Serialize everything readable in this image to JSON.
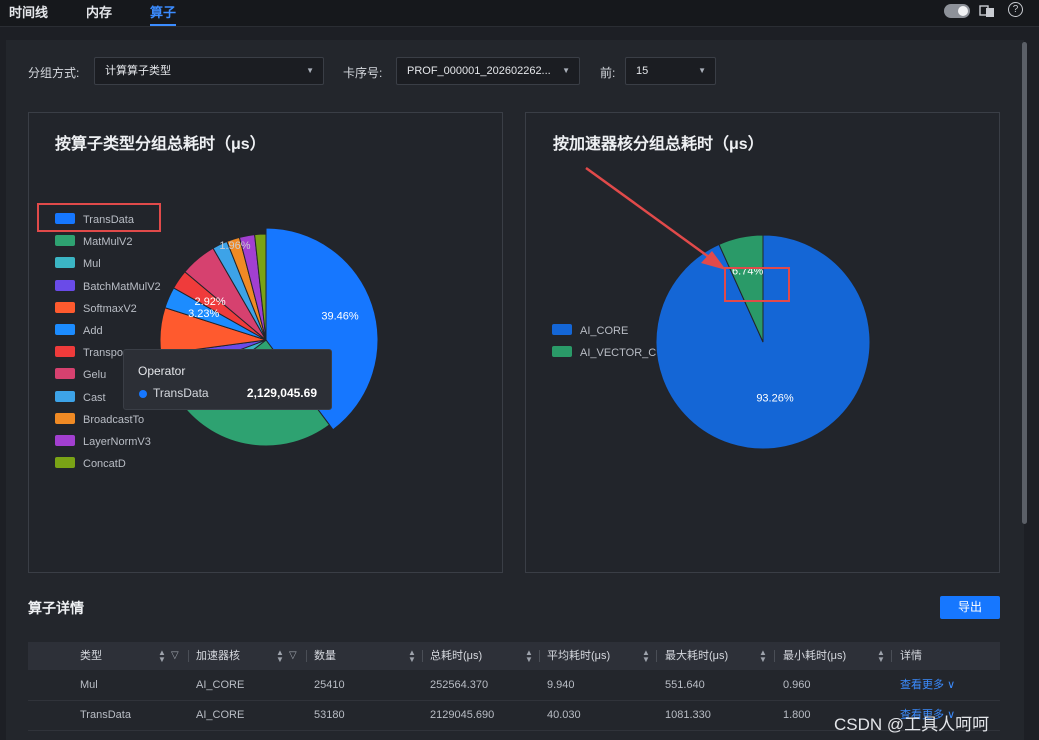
{
  "tabs": [
    {
      "label": "时间线"
    },
    {
      "label": "内存"
    },
    {
      "label": "算子"
    }
  ],
  "top_icons": {
    "toggle": "toggle-switch",
    "translate": "translate-icon",
    "help": "help-icon",
    "help_glyph": "?"
  },
  "filters": {
    "group_label": "分组方式:",
    "group_value": "计算算子类型",
    "card_label": "卡序号:",
    "card_value": "PROF_000001_202602262...",
    "top_label": "前:",
    "top_value": "15"
  },
  "chart_left": {
    "title": "按算子类型分组总耗时（μs）",
    "legend": [
      {
        "name": "TransData",
        "color": "#1677ff"
      },
      {
        "name": "MatMulV2",
        "color": "#2ea271"
      },
      {
        "name": "Mul",
        "color": "#3bb5c4"
      },
      {
        "name": "BatchMatMulV2",
        "color": "#6a4be8"
      },
      {
        "name": "SoftmaxV2",
        "color": "#ff5a2e"
      },
      {
        "name": "Add",
        "color": "#1c8cff"
      },
      {
        "name": "Transpo",
        "color": "#ef3b3b"
      },
      {
        "name": "Gelu",
        "color": "#d6416f"
      },
      {
        "name": "Cast",
        "color": "#3da3e8"
      },
      {
        "name": "BroadcastTo",
        "color": "#f08a24"
      },
      {
        "name": "LayerNormV3",
        "color": "#a23fd0"
      },
      {
        "name": "ConcatD",
        "color": "#7aa316"
      }
    ],
    "tooltip": {
      "header": "Operator",
      "name": "TransData",
      "value": "2,129,045.69"
    }
  },
  "chart_right": {
    "title": "按加速器核分组总耗时（μs）",
    "legend": [
      {
        "name": "AI_CORE",
        "color": "#1466d6"
      },
      {
        "name": "AI_VECTOR_CORE",
        "color": "#2a9a68"
      }
    ]
  },
  "chart_data": [
    {
      "type": "pie",
      "title": "按算子类型分组总耗时（μs）",
      "series_label": "Operator",
      "slices": [
        {
          "name": "TransData",
          "value": 39.46,
          "label": "39.46%",
          "color": "#1677ff"
        },
        {
          "name": "MatMulV2",
          "value": 24.6,
          "color": "#2ea271"
        },
        {
          "name": "Mul",
          "value": 4.68,
          "color": "#3bb5c4"
        },
        {
          "name": "BatchMatMulV2",
          "value": 3.52,
          "label": "3.52%",
          "color": "#6a4be8"
        },
        {
          "name": "SoftmaxV2",
          "value": 7.0,
          "color": "#ff5a2e"
        },
        {
          "name": "Add",
          "value": 3.23,
          "label": "3.23%",
          "color": "#1c8cff"
        },
        {
          "name": "Transpo",
          "value": 2.92,
          "label": "2.92%",
          "color": "#ef3b3b"
        },
        {
          "name": "Gelu",
          "value": 5.5,
          "color": "#d6416f"
        },
        {
          "name": "Cast",
          "value": 2.3,
          "color": "#3da3e8"
        },
        {
          "name": "BroadcastTo",
          "value": 1.96,
          "label": "1.96%",
          "color": "#f08a24"
        },
        {
          "name": "LayerNormV3",
          "value": 2.3,
          "color": "#a23fd0"
        },
        {
          "name": "ConcatD",
          "value": 1.7,
          "color": "#7aa316"
        }
      ]
    },
    {
      "type": "pie",
      "title": "按加速器核分组总耗时（μs）",
      "slices": [
        {
          "name": "AI_CORE",
          "value": 93.26,
          "label": "93.26%",
          "color": "#1466d6"
        },
        {
          "name": "AI_VECTOR_CORE",
          "value": 6.74,
          "label": "6.74%",
          "color": "#2a9a68"
        }
      ]
    }
  ],
  "details": {
    "title": "算子详情",
    "export_label": "导出",
    "columns": [
      "类型",
      "加速器核",
      "数量",
      "总耗时(μs)",
      "平均耗时(μs)",
      "最大耗时(μs)",
      "最小耗时(μs)",
      "详情"
    ],
    "rows": [
      {
        "type": "Mul",
        "core": "AI_CORE",
        "count": "25410",
        "total": "252564.370",
        "avg": "9.940",
        "max": "551.640",
        "min": "0.960",
        "more": "查看更多"
      },
      {
        "type": "TransData",
        "core": "AI_CORE",
        "count": "53180",
        "total": "2129045.690",
        "avg": "40.030",
        "max": "1081.330",
        "min": "1.800",
        "more": "查看更多"
      }
    ]
  },
  "watermark": "CSDN @工具人呵呵"
}
